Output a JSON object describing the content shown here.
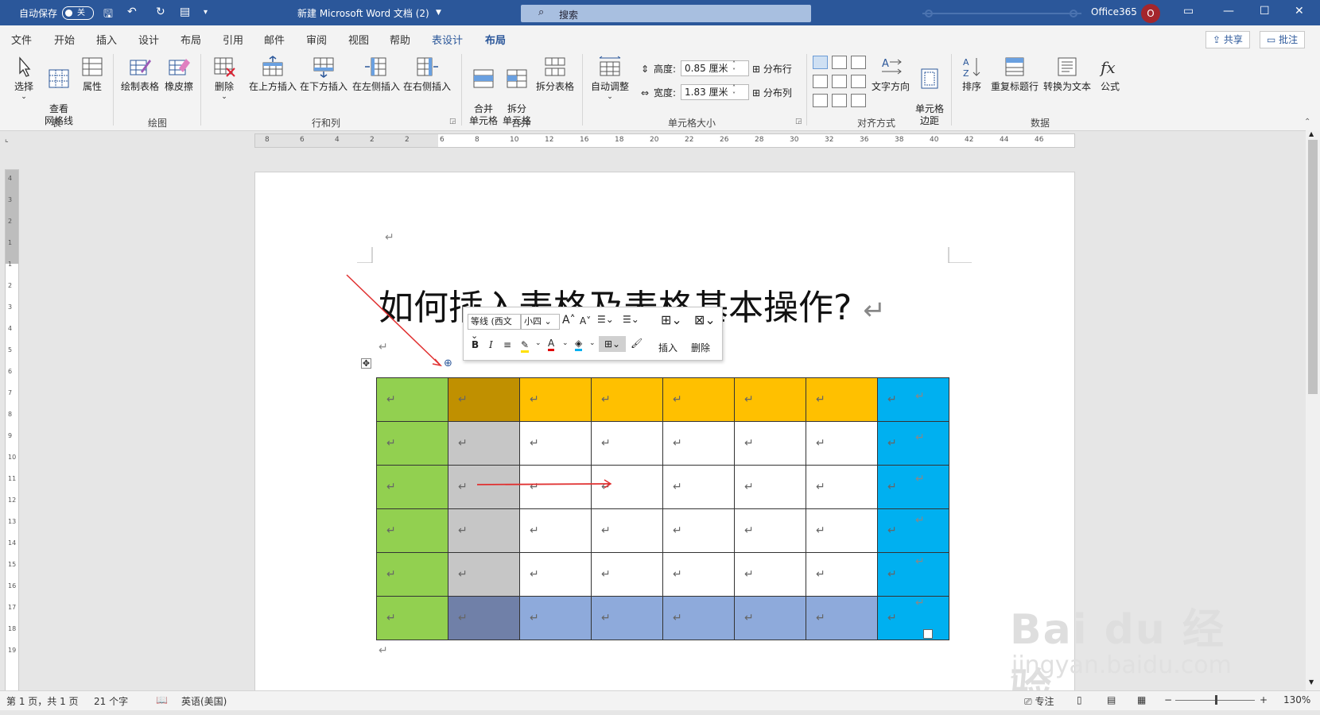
{
  "titlebar": {
    "autosave_label": "自动保存",
    "autosave_state": "关",
    "doc_title": "新建 Microsoft Word 文档 (2)",
    "search_placeholder": "搜索",
    "account": "Office365",
    "avatar_letter": "O"
  },
  "menu": {
    "items": [
      "文件",
      "开始",
      "插入",
      "设计",
      "布局",
      "引用",
      "邮件",
      "审阅",
      "视图",
      "帮助",
      "表设计",
      "布局"
    ],
    "share": "共享",
    "comments": "批注"
  },
  "ribbon": {
    "table_group": {
      "label": "表",
      "select": "选择",
      "gridlines": "查看\n网格线",
      "properties": "属性"
    },
    "draw_group": {
      "label": "绘图",
      "draw_table": "绘制表格",
      "eraser": "橡皮擦"
    },
    "rowcol_group": {
      "label": "行和列",
      "delete": "删除",
      "insert_above": "在上方插入",
      "insert_below": "在下方插入",
      "insert_left": "在左侧插入",
      "insert_right": "在右侧插入"
    },
    "merge_group": {
      "label": "合并",
      "merge_cells": "合并\n单元格",
      "split_cells": "拆分\n单元格",
      "split_table": "拆分表格"
    },
    "cellsize_group": {
      "label": "单元格大小",
      "autofit": "自动调整",
      "height_label": "高度:",
      "height_value": "0.85 厘米",
      "width_label": "宽度:",
      "width_value": "1.83 厘米",
      "dist_rows": "分布行",
      "dist_cols": "分布列"
    },
    "align_group": {
      "label": "对齐方式",
      "text_dir": "文字方向",
      "cell_margins": "单元格\n边距"
    },
    "data_group": {
      "label": "数据",
      "sort": "排序",
      "repeat_header": "重复标题行",
      "to_text": "转换为文本",
      "formula": "公式"
    }
  },
  "ruler": {
    "h_ticks": [
      "8",
      "6",
      "4",
      "2",
      "2",
      "6",
      "8",
      "10",
      "12",
      "16",
      "18",
      "20",
      "22",
      "26",
      "28",
      "30",
      "32",
      "36",
      "38",
      "40",
      "42",
      "44",
      "46"
    ],
    "v_ticks": [
      "4",
      "3",
      "2",
      "1",
      "1",
      "2",
      "3",
      "4",
      "5",
      "6",
      "7",
      "8",
      "9",
      "10",
      "11",
      "12",
      "13",
      "14",
      "15",
      "16",
      "17",
      "18",
      "19"
    ]
  },
  "document": {
    "title": "如何插入表格及表格基本操作?",
    "return_mark": "↵",
    "table_colors": [
      [
        "#92d050",
        "#c09000",
        "#ffc000",
        "#ffc000",
        "#ffc000",
        "#ffc000",
        "#ffc000",
        "#00b0f0"
      ],
      [
        "#92d050",
        "#c6c6c6",
        "#ffffff",
        "#ffffff",
        "#ffffff",
        "#ffffff",
        "#ffffff",
        "#00b0f0"
      ],
      [
        "#92d050",
        "#c6c6c6",
        "#ffffff",
        "#ffffff",
        "#ffffff",
        "#ffffff",
        "#ffffff",
        "#00b0f0"
      ],
      [
        "#92d050",
        "#c6c6c6",
        "#ffffff",
        "#ffffff",
        "#ffffff",
        "#ffffff",
        "#ffffff",
        "#00b0f0"
      ],
      [
        "#92d050",
        "#c6c6c6",
        "#ffffff",
        "#ffffff",
        "#ffffff",
        "#ffffff",
        "#ffffff",
        "#00b0f0"
      ],
      [
        "#92d050",
        "#7080a8",
        "#8eaadb",
        "#8eaadb",
        "#8eaadb",
        "#8eaadb",
        "#8eaadb",
        "#00b0f0"
      ]
    ]
  },
  "minitoolbar": {
    "font": "等线 (西文",
    "size": "小四",
    "insert": "插入",
    "delete": "删除"
  },
  "status": {
    "page": "第 1 页，共 1 页",
    "words": "21 个字",
    "language": "英语(美国)",
    "focus": "专注",
    "zoom": "130%"
  },
  "watermark": {
    "text": "Bai du 经验",
    "url": "jingyan.baidu.com"
  },
  "colors": {
    "accent": "#2b579a",
    "arrow": "#e03030"
  }
}
